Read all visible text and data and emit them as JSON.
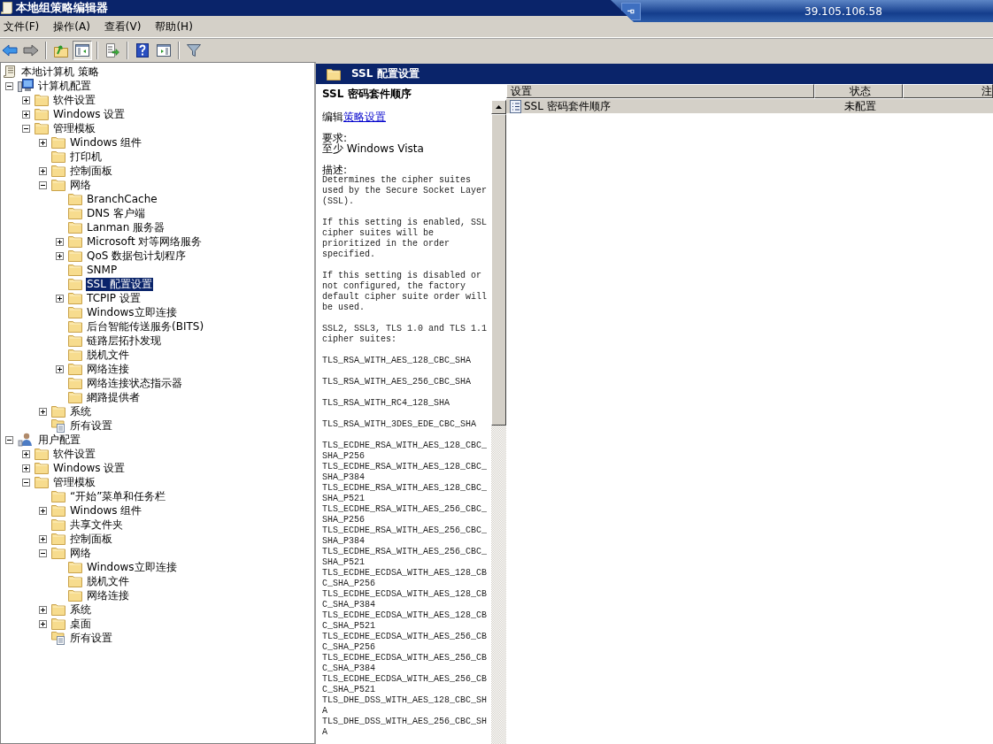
{
  "window": {
    "title": "本地组策略编辑器"
  },
  "remote_bar": {
    "address": "39.105.106.58"
  },
  "menu": [
    "文件(F)",
    "操作(A)",
    "查看(V)",
    "帮助(H)"
  ],
  "toolbar": [
    {
      "kind": "back",
      "pressed": false
    },
    {
      "kind": "forward",
      "pressed": false
    },
    {
      "kind": "separator"
    },
    {
      "kind": "up-folder",
      "pressed": false
    },
    {
      "kind": "tree-pane",
      "pressed": true
    },
    {
      "kind": "separator"
    },
    {
      "kind": "export",
      "pressed": false
    },
    {
      "kind": "separator"
    },
    {
      "kind": "help",
      "pressed": false
    },
    {
      "kind": "action-pane",
      "pressed": false
    },
    {
      "kind": "separator"
    },
    {
      "kind": "filter",
      "pressed": false
    }
  ],
  "tree": {
    "label": "本地计算机 策略",
    "kind": "policy",
    "selected": false,
    "children": [
      {
        "label": "计算机配置",
        "kind": "computer",
        "expanded": true,
        "selected": false,
        "children": [
          {
            "label": "软件设置",
            "kind": "folder",
            "expanded": false,
            "selected": false
          },
          {
            "label": "Windows 设置",
            "kind": "folder",
            "expanded": false,
            "selected": false
          },
          {
            "label": "管理模板",
            "kind": "folder",
            "expanded": true,
            "selected": false,
            "children": [
              {
                "label": "Windows 组件",
                "kind": "folder",
                "expanded": false,
                "selected": false
              },
              {
                "label": "打印机",
                "kind": "folder",
                "selected": false
              },
              {
                "label": "控制面板",
                "kind": "folder",
                "expanded": false,
                "selected": false
              },
              {
                "label": "网络",
                "kind": "folder",
                "expanded": true,
                "selected": false,
                "children": [
                  {
                    "label": "BranchCache",
                    "kind": "folder",
                    "selected": false
                  },
                  {
                    "label": "DNS 客户端",
                    "kind": "folder",
                    "selected": false
                  },
                  {
                    "label": "Lanman 服务器",
                    "kind": "folder",
                    "selected": false
                  },
                  {
                    "label": "Microsoft 对等网络服务",
                    "kind": "folder",
                    "expanded": false,
                    "selected": false
                  },
                  {
                    "label": "QoS 数据包计划程序",
                    "kind": "folder",
                    "expanded": false,
                    "selected": false
                  },
                  {
                    "label": "SNMP",
                    "kind": "folder",
                    "selected": false
                  },
                  {
                    "label": "SSL 配置设置",
                    "kind": "folder",
                    "selected": true
                  },
                  {
                    "label": "TCPIP 设置",
                    "kind": "folder",
                    "expanded": false,
                    "selected": false
                  },
                  {
                    "label": "Windows立即连接",
                    "kind": "folder",
                    "selected": false
                  },
                  {
                    "label": "后台智能传送服务(BITS)",
                    "kind": "folder",
                    "selected": false
                  },
                  {
                    "label": "链路层拓扑发现",
                    "kind": "folder",
                    "selected": false
                  },
                  {
                    "label": "脱机文件",
                    "kind": "folder",
                    "selected": false
                  },
                  {
                    "label": "网络连接",
                    "kind": "folder",
                    "expanded": false,
                    "selected": false
                  },
                  {
                    "label": "网络连接状态指示器",
                    "kind": "folder",
                    "selected": false
                  },
                  {
                    "label": "網路提供者",
                    "kind": "folder",
                    "selected": false
                  }
                ]
              },
              {
                "label": "系统",
                "kind": "folder",
                "expanded": false,
                "selected": false
              },
              {
                "label": "所有设置",
                "kind": "all-settings",
                "selected": false
              }
            ]
          }
        ]
      },
      {
        "label": "用户配置",
        "kind": "user",
        "expanded": true,
        "selected": false,
        "children": [
          {
            "label": "软件设置",
            "kind": "folder",
            "expanded": false,
            "selected": false
          },
          {
            "label": "Windows 设置",
            "kind": "folder",
            "expanded": false,
            "selected": false
          },
          {
            "label": "管理模板",
            "kind": "folder",
            "expanded": true,
            "selected": false,
            "children": [
              {
                "label": "“开始”菜单和任务栏",
                "kind": "folder",
                "selected": false
              },
              {
                "label": "Windows 组件",
                "kind": "folder",
                "expanded": false,
                "selected": false
              },
              {
                "label": "共享文件夹",
                "kind": "folder",
                "selected": false
              },
              {
                "label": "控制面板",
                "kind": "folder",
                "expanded": false,
                "selected": false
              },
              {
                "label": "网络",
                "kind": "folder",
                "expanded": true,
                "selected": false,
                "children": [
                  {
                    "label": "Windows立即连接",
                    "kind": "folder",
                    "selected": false
                  },
                  {
                    "label": "脱机文件",
                    "kind": "folder",
                    "selected": false
                  },
                  {
                    "label": "网络连接",
                    "kind": "folder",
                    "selected": false
                  }
                ]
              },
              {
                "label": "系统",
                "kind": "folder",
                "expanded": false,
                "selected": false
              },
              {
                "label": "桌面",
                "kind": "folder",
                "expanded": false,
                "selected": false
              },
              {
                "label": "所有设置",
                "kind": "all-settings",
                "selected": false
              }
            ]
          }
        ]
      }
    ]
  },
  "header": {
    "title": "SSL 配置设置"
  },
  "extended": {
    "title": "SSL 密码套件顺序",
    "edit_prefix": "编辑",
    "edit_link": "策略设置",
    "requirements_label": "要求:",
    "requirements": "至少 Windows Vista",
    "description_label": "描述:",
    "paragraphs": [
      "Determines the cipher suites used by the Secure Socket Layer (SSL).",
      "If this setting is enabled, SSL cipher suites will be prioritized in the order specified.",
      "If this setting is disabled or not configured, the factory default cipher suite order will be used.",
      "SSL2, SSL3, TLS 1.0 and TLS 1.1 cipher suites:",
      "TLS_RSA_WITH_AES_128_CBC_SHA",
      "TLS_RSA_WITH_AES_256_CBC_SHA",
      "TLS_RSA_WITH_RC4_128_SHA",
      "TLS_RSA_WITH_3DES_EDE_CBC_SHA"
    ],
    "suites": [
      "TLS_ECDHE_RSA_WITH_AES_128_CBC_SHA_P256",
      "TLS_ECDHE_RSA_WITH_AES_128_CBC_SHA_P384",
      "TLS_ECDHE_RSA_WITH_AES_128_CBC_SHA_P521",
      "TLS_ECDHE_RSA_WITH_AES_256_CBC_SHA_P256",
      "TLS_ECDHE_RSA_WITH_AES_256_CBC_SHA_P384",
      "TLS_ECDHE_RSA_WITH_AES_256_CBC_SHA_P521",
      "TLS_ECDHE_ECDSA_WITH_AES_128_CBC_SHA_P256",
      "TLS_ECDHE_ECDSA_WITH_AES_128_CBC_SHA_P384",
      "TLS_ECDHE_ECDSA_WITH_AES_128_CBC_SHA_P521",
      "TLS_ECDHE_ECDSA_WITH_AES_256_CBC_SHA_P256",
      "TLS_ECDHE_ECDSA_WITH_AES_256_CBC_SHA_P384",
      "TLS_ECDHE_ECDSA_WITH_AES_256_CBC_SHA_P521",
      "TLS_DHE_DSS_WITH_AES_128_CBC_SHA",
      "TLS_DHE_DSS_WITH_AES_256_CBC_SHA"
    ]
  },
  "table": {
    "columns": [
      "设置",
      "状态",
      "注"
    ],
    "rows": [
      {
        "cells": [
          "SSL 密码套件顺序",
          "未配置"
        ],
        "selected": true
      }
    ]
  }
}
